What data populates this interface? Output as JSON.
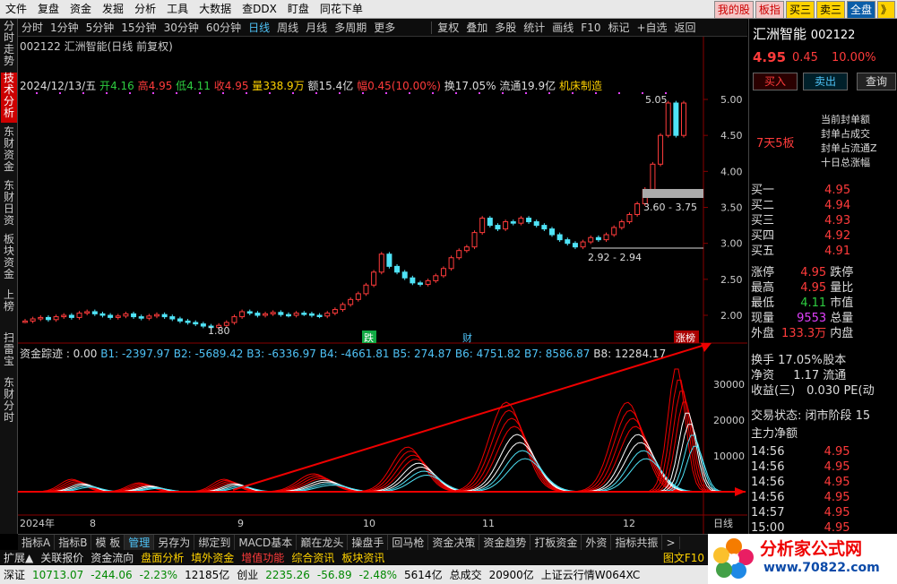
{
  "menubar": {
    "items": [
      "文件",
      "复盘",
      "资金",
      "发掘",
      "分析",
      "工具",
      "大数据",
      "查DDX",
      "盯盘",
      "同花下单"
    ],
    "right_buttons": [
      "我的股",
      "板指",
      "买三",
      "卖三",
      "全盘",
      "》"
    ]
  },
  "leftbar": [
    "分时走势",
    "技术分析",
    "东财资金",
    "东财日资",
    "板块资金",
    "上榜",
    "扫雷宝",
    "东财分时"
  ],
  "toolbar": {
    "left": [
      "分时",
      "1分钟",
      "5分钟",
      "15分钟",
      "30分钟",
      "60分钟",
      "日线",
      "周线",
      "月线",
      "多周期",
      "更多"
    ],
    "active": "日线",
    "right": [
      "复权",
      "叠加",
      "多股",
      "统计",
      "画线",
      "F10",
      "标记",
      "+自选",
      "返回"
    ]
  },
  "chart_title": "002122 汇洲智能(日线 前复权)",
  "info": {
    "date": "2024/12/13/五",
    "open_label": "开",
    "open": "4.16",
    "high_label": "高",
    "high": "4.95",
    "low_label": "低",
    "low": "4.11",
    "close_label": "收",
    "close": "4.95",
    "vol_label": "量",
    "vol": "338.9万",
    "amt_label": "额",
    "amt": "15.4亿",
    "amp_label": "幅",
    "amp": "0.45(10.00%)",
    "turn_label": "换",
    "turn": "17.05%",
    "float_label": "流通",
    "float": "19.9亿",
    "sector": "机床制造"
  },
  "annotations": {
    "a1": "5.05",
    "a2": "3.60 - 3.75",
    "a3": "2.92 - 2.94",
    "a4": "1.80",
    "event_die": "跌",
    "event_cai": "财",
    "event_zhangbang": "涨榜"
  },
  "subtitle": {
    "name": "资金踪迹 : 0.00",
    "b1": "B1: -2397.97",
    "b2": "B2: -5689.42",
    "b3": "B3: -6336.97",
    "b4": "B4: -4661.81",
    "b5": "B5: 274.87",
    "b6": "B6: 4751.82",
    "b7": "B7: 8586.87",
    "b8": "B8: 12284.17"
  },
  "chart_data": {
    "type": "candlestick",
    "title": "002122 汇洲智能(日线 前复权)",
    "y_ticks": [
      "5.00",
      "4.50",
      "4.00",
      "3.50",
      "3.00",
      "2.50",
      "2.00"
    ],
    "x_ticks": [
      "2024年",
      "8",
      "9",
      "10",
      "11",
      "12"
    ],
    "ind_y_ticks": [
      "30000",
      "20000",
      "10000"
    ],
    "closes": [
      1.92,
      1.95,
      1.97,
      1.94,
      1.98,
      2.0,
      1.97,
      2.03,
      2.05,
      2.02,
      2.0,
      1.97,
      1.99,
      2.02,
      1.98,
      1.96,
      1.99,
      2.01,
      1.98,
      1.95,
      1.92,
      1.9,
      1.88,
      1.85,
      1.83,
      1.86,
      1.9,
      1.98,
      2.05,
      2.03,
      2.0,
      2.02,
      2.04,
      2.01,
      2.0,
      2.03,
      2.02,
      2.0,
      1.99,
      2.03,
      2.08,
      2.15,
      2.22,
      2.3,
      2.42,
      2.6,
      2.85,
      2.68,
      2.6,
      2.52,
      2.45,
      2.43,
      2.48,
      2.55,
      2.65,
      2.8,
      2.9,
      2.95,
      3.15,
      3.35,
      3.25,
      3.2,
      3.3,
      3.28,
      3.35,
      3.3,
      3.25,
      3.2,
      3.12,
      3.05,
      3.0,
      2.95,
      3.02,
      3.08,
      3.05,
      3.12,
      3.22,
      3.3,
      3.4,
      3.55,
      3.75,
      4.1,
      4.5,
      4.95,
      4.5,
      4.95
    ],
    "volume_label": "量 338.9万"
  },
  "right_panel": {
    "name": "汇洲智能",
    "code": "002122",
    "price": "4.95",
    "chg": "0.45",
    "pct": "10.00%",
    "btn_buy": "买入",
    "btn_sell": "卖出",
    "btn_query": "查询",
    "seal_title": "7天5板",
    "seal": [
      "当前封单额",
      "封单占成交",
      "封单占流通Z",
      "十日总涨幅"
    ],
    "asks": [
      {
        "l": "买一",
        "p": "4.95"
      },
      {
        "l": "买二",
        "p": "4.94"
      },
      {
        "l": "买三",
        "p": "4.93"
      },
      {
        "l": "买四",
        "p": "4.92"
      },
      {
        "l": "买五",
        "p": "4.91"
      }
    ],
    "stats": [
      {
        "l": "涨停",
        "v": "4.95",
        "l2": "跌停"
      },
      {
        "l": "最高",
        "v": "4.95",
        "l2": "量比"
      },
      {
        "l": "最低",
        "v": "4.11",
        "l2": "市值"
      },
      {
        "l": "现量",
        "v": "9553",
        "l2": "总量"
      },
      {
        "l": "外盘",
        "v": "133.3万",
        "l2": "内盘"
      }
    ],
    "stats2": [
      {
        "l": "换手",
        "v": "17.05%",
        "l2": "股本"
      },
      {
        "l": "净资",
        "v": "1.17",
        "l2": "流通"
      },
      {
        "l": "收益(三)",
        "v": "0.030",
        "l2": "PE(动"
      }
    ],
    "trade_state": "交易状态: 闭市阶段",
    "trade_state_num": "15",
    "main_net": "主力净额",
    "ticks": [
      {
        "t": "14:56",
        "p": "4.95"
      },
      {
        "t": "14:56",
        "p": "4.95"
      },
      {
        "t": "14:56",
        "p": "4.95"
      },
      {
        "t": "14:56",
        "p": "4.95"
      },
      {
        "t": "14:57",
        "p": "4.95"
      },
      {
        "t": "15:00",
        "p": "4.95"
      }
    ]
  },
  "bottom_tabs": [
    "指标A",
    "指标B",
    "模 板",
    "管理",
    "另存为",
    "绑定到",
    "MACD基本",
    "巅在龙头",
    "操盘手",
    "回马枪",
    "资金决策",
    "资金趋势",
    "打板资金",
    "外资",
    "指标共振",
    ">"
  ],
  "bottom_active": "管理",
  "row2": [
    "扩展▲",
    "关联报价",
    "资金流向",
    "盘面分析",
    "填外资金",
    "增值功能",
    "综合资讯",
    "板块资讯"
  ],
  "row2_right": "图文F10",
  "statusbar": {
    "sz": "深证",
    "sz_v": "10713.07",
    "sz_c": "-244.06",
    "sz_p": "-2.23%",
    "sz_amt": "12185亿",
    "cy": "创业",
    "cy_v": "2235.26",
    "cy_c": "-56.89",
    "cy_p": "-2.48%",
    "cy_amt": "5614亿",
    "total": "总成交",
    "total_v": "20900亿",
    "server": "上证云行情W064XC"
  },
  "logo": {
    "text": "分析家公式网",
    "url": "www.70822.com"
  },
  "colors": {
    "up": "#ff3b3b",
    "down": "#4fe3f7",
    "accent": "#ffd200"
  }
}
